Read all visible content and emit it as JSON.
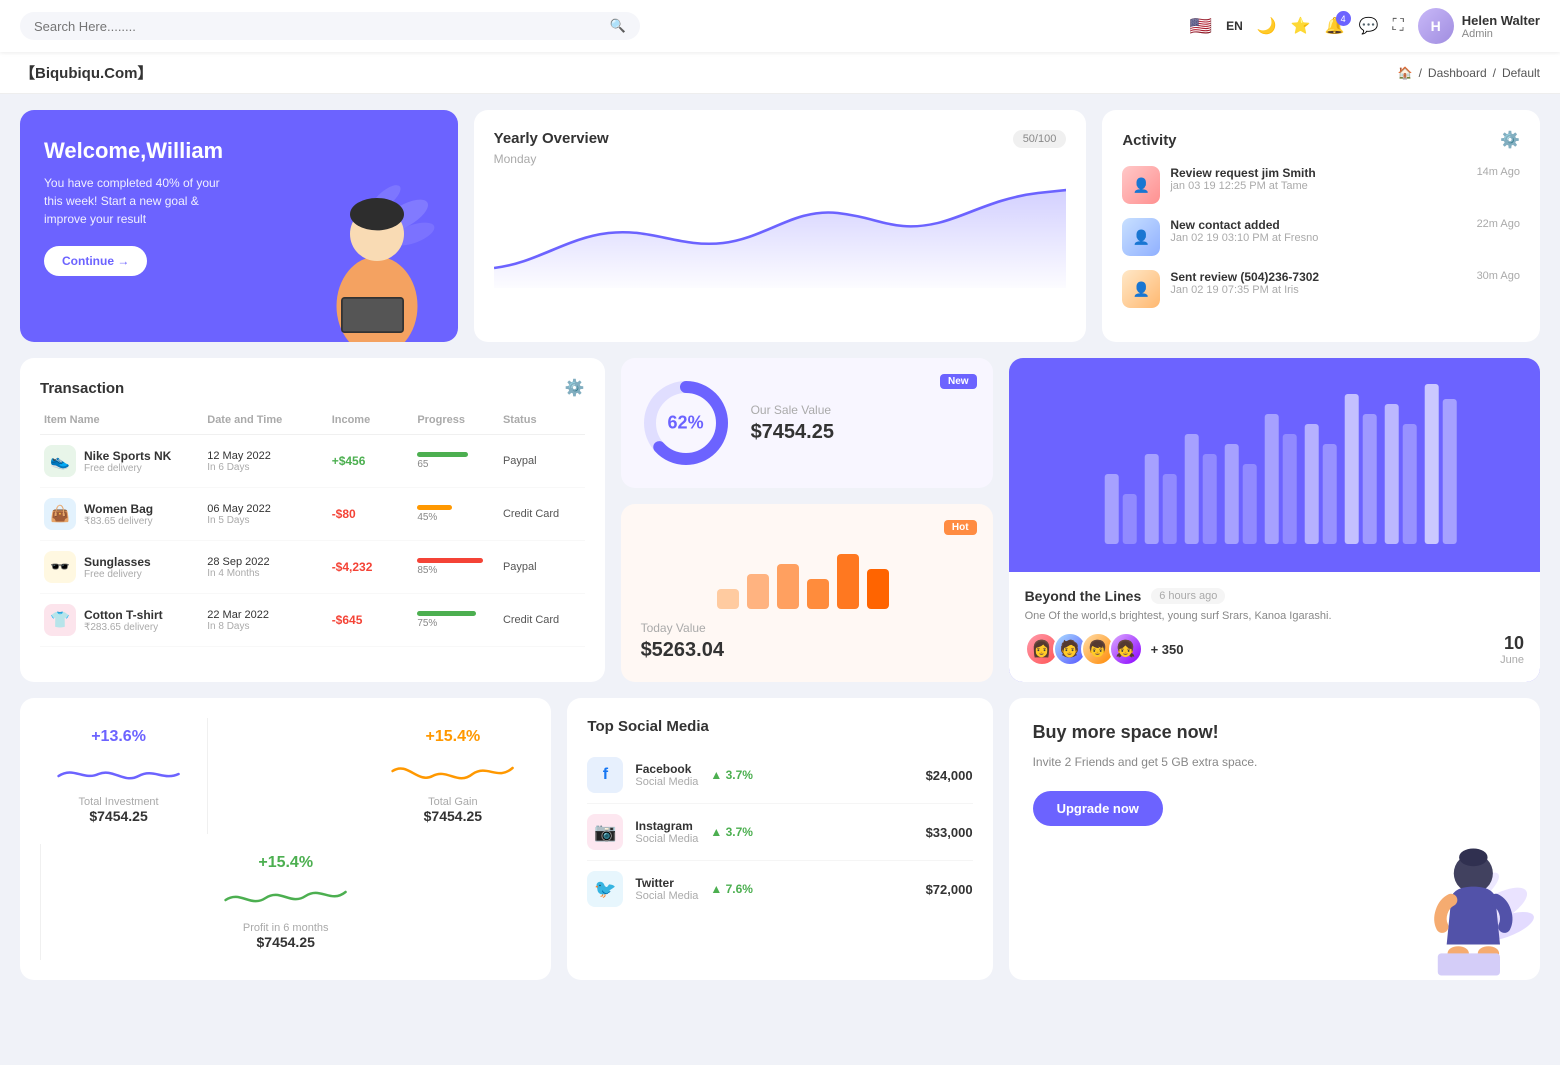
{
  "nav": {
    "search_placeholder": "Search Here........",
    "lang": "EN",
    "user_name": "Helen Walter",
    "user_role": "Admin",
    "bell_count": "4"
  },
  "breadcrumb": {
    "brand": "【Biqubiqu.Com】",
    "home": "🏠",
    "dashboard": "Dashboard",
    "current": "Default"
  },
  "welcome": {
    "title": "Welcome,William",
    "description": "You have completed 40% of your this week! Start a new goal & improve your result",
    "button": "Continue →"
  },
  "yearly_overview": {
    "title": "Yearly Overview",
    "subtitle": "Monday",
    "badge": "50/100"
  },
  "activity": {
    "title": "Activity",
    "items": [
      {
        "title": "Review request jim Smith",
        "sub": "jan 03 19 12:25 PM at Tame",
        "time": "14m Ago"
      },
      {
        "title": "New contact added",
        "sub": "Jan 02 19 03:10 PM at Fresno",
        "time": "22m Ago"
      },
      {
        "title": "Sent review (504)236-7302",
        "sub": "Jan 02 19 07:35 PM at Iris",
        "time": "30m Ago"
      }
    ]
  },
  "transaction": {
    "title": "Transaction",
    "columns": [
      "Item Name",
      "Date and Time",
      "Income",
      "Progress",
      "Status"
    ],
    "rows": [
      {
        "name": "Nike Sports NK",
        "sub": "Free delivery",
        "date": "12 May 2022",
        "days": "In 6 Days",
        "income": "+$456",
        "income_type": "pos",
        "progress": 65,
        "progress_color": "#4caf50",
        "status": "Paypal",
        "icon_bg": "#e8f5e9",
        "icon": "👟"
      },
      {
        "name": "Women Bag",
        "sub": "₹83.65 delivery",
        "date": "06 May 2022",
        "days": "In 5 Days",
        "income": "-$80",
        "income_type": "neg",
        "progress": 45,
        "progress_color": "#ff9800",
        "status": "Credit Card",
        "icon_bg": "#e3f2fd",
        "icon": "👜"
      },
      {
        "name": "Sunglasses",
        "sub": "Free delivery",
        "date": "28 Sep 2022",
        "days": "In 4 Months",
        "income": "-$4,232",
        "income_type": "neg",
        "progress": 85,
        "progress_color": "#f44336",
        "status": "Paypal",
        "icon_bg": "#fff8e1",
        "icon": "🕶️"
      },
      {
        "name": "Cotton T-shirt",
        "sub": "₹283.65 delivery",
        "date": "22 Mar 2022",
        "days": "In 8 Days",
        "income": "-$645",
        "income_type": "neg",
        "progress": 75,
        "progress_color": "#4caf50",
        "status": "Credit Card",
        "icon_bg": "#fce4ec",
        "icon": "👕"
      }
    ]
  },
  "sale_new": {
    "badge": "New",
    "percent": "62%",
    "label": "Our Sale Value",
    "value": "$7454.25"
  },
  "sale_hot": {
    "badge": "Hot",
    "label": "Today Value",
    "value": "$5263.04"
  },
  "beyond": {
    "title": "Beyond the Lines",
    "time": "6 hours ago",
    "desc": "One Of the world,s brightest, young surf Srars, Kanoa Igarashi.",
    "plus_count": "+ 350",
    "date": "10",
    "date_sub": "June"
  },
  "mini_stats": [
    {
      "percent": "+13.6%",
      "label": "Total Investment",
      "value": "$7454.25",
      "color": "#6c63ff"
    },
    {
      "percent": "+15.4%",
      "label": "Total Gain",
      "value": "$7454.25",
      "color": "#ff9800"
    },
    {
      "percent": "+15.4%",
      "label": "Profit in 6 months",
      "value": "$7454.25",
      "color": "#4caf50"
    }
  ],
  "social_media": {
    "title": "Top Social Media",
    "items": [
      {
        "name": "Facebook",
        "type": "Social Media",
        "growth": "3.7%",
        "amount": "$24,000",
        "color": "#1877f2",
        "icon": "f"
      },
      {
        "name": "Instagram",
        "type": "Social Media",
        "growth": "3.7%",
        "amount": "$33,000",
        "color": "#e1306c",
        "icon": "📷"
      },
      {
        "name": "Twitter",
        "type": "Social Media",
        "growth": "7.6%",
        "amount": "$72,000",
        "color": "#1da1f2",
        "icon": "🐦"
      }
    ]
  },
  "upgrade": {
    "title": "Buy more space now!",
    "desc": "Invite 2 Friends and get 5 GB extra space.",
    "button": "Upgrade now"
  }
}
